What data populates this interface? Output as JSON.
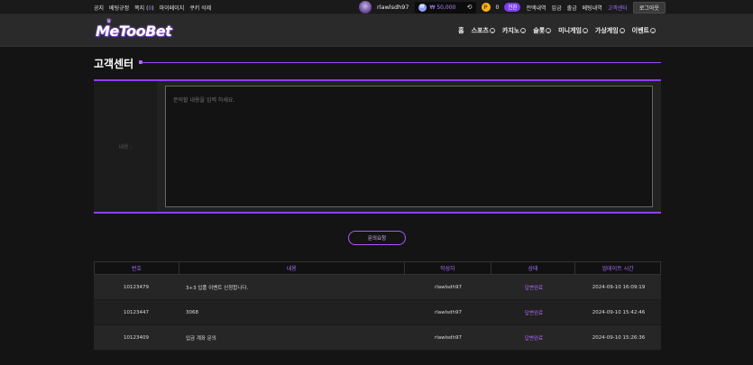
{
  "topbar": {
    "links_left": [
      "공지",
      "베팅규정",
      "쪽지 (",
      "0",
      ")",
      "마이페이지",
      "쿠키 삭제"
    ],
    "username": "rlawlsdh97",
    "balance": "₩ 50,000",
    "points": "0",
    "convert_label": "전환",
    "links_right": [
      "전액내역",
      "입금",
      "출금",
      "베팅내역",
      "고객센터"
    ],
    "logout_label": "로그아웃"
  },
  "header": {
    "logo": "MeTooBet",
    "nav": [
      "홈",
      "스포츠",
      "카지노",
      "슬롯",
      "미니게임",
      "가상게임",
      "이벤트"
    ]
  },
  "page": {
    "title": "고객센터"
  },
  "form": {
    "label": "내용 :",
    "placeholder": "문의할 내용을 입력 하세요.",
    "submit_label": "문의요청"
  },
  "table": {
    "headers": [
      "번호",
      "내용",
      "작성자",
      "상태",
      "업데이트 시간"
    ],
    "rows": [
      {
        "no": "10123479",
        "content": "3+3 입플 이벤트 신청합니다.",
        "writer": "rlawlsdh97",
        "status": "답변완료",
        "time": "2024-09-10 16:09:19"
      },
      {
        "no": "10123447",
        "content": "3068",
        "writer": "rlawlsdh97",
        "status": "답변완료",
        "time": "2024-09-10 15:42:46"
      },
      {
        "no": "10123409",
        "content": "입금 계좌 문의",
        "writer": "rlawlsdh97",
        "status": "답변완료",
        "time": "2024-09-10 15:26:36"
      }
    ]
  },
  "colors": {
    "accent": "#9a4dff",
    "background": "#141414"
  }
}
